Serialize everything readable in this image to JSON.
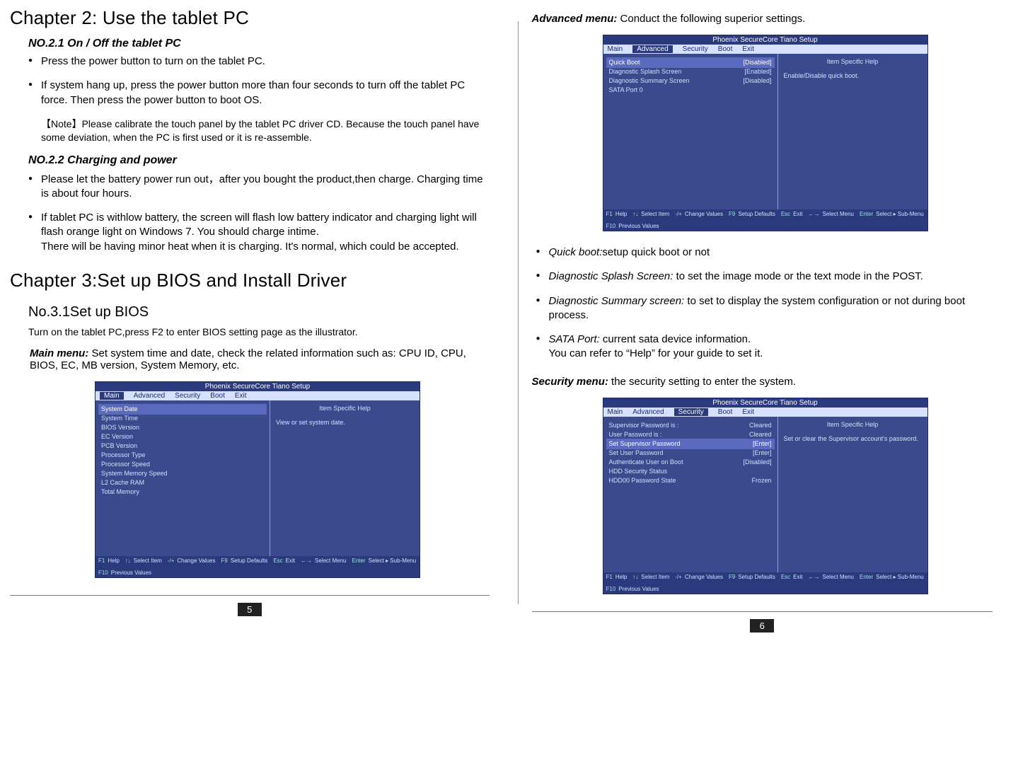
{
  "left": {
    "chapter2_title": "Chapter 2: Use the tablet PC",
    "sec21_title": "NO.2.1 On / Off the tablet PC",
    "sec21_items": [
      "Press the power button to turn on the tablet PC.",
      "If system hang up, press the power button more than four seconds to turn off  the tablet PC force. Then press the power button to boot OS."
    ],
    "note": "【Note】Please calibrate the touch panel by the tablet PC driver CD. Because the touch panel have some deviation, when the PC is first used or it is re-assemble.",
    "sec22_title": "NO.2.2 Charging and power",
    "sec22_items": [
      "Please let the battery power run out，after you bought the product,then charge. Charging time is about four hours.",
      "If tablet PC is withlow battery, the screen will flash low battery indicator and charging light will flash orange light on Windows 7. You should charge intime.\nThere will be having minor heat when it is charging. It's normal, which could be accepted."
    ],
    "chapter3_title": "Chapter 3:Set up  BIOS and Install Driver",
    "sec31_title": "No.3.1Set up  BIOS",
    "sec31_intro": "Turn on the tablet PC,press F2 to enter BIOS setting page as the illustrator.",
    "main_menu_lead": "Main menu:",
    "main_menu_desc": " Set system time and date, check the related information such as: CPU ID, CPU, BIOS, EC, MB version, System Memory, etc.",
    "page_num": "5"
  },
  "right": {
    "adv_lead": "Advanced menu:",
    "adv_desc": " Conduct the following superior settings.",
    "adv_items": [
      {
        "lead": "Quick boot:",
        "rest": "setup quick boot or not"
      },
      {
        "lead": "Diagnostic Splash Screen:",
        "rest": " to set the image mode or the text  mode in the POST."
      },
      {
        "lead": "Diagnostic Summary screen:",
        "rest": " to set to display the system configuration or not during boot process."
      },
      {
        "lead": "SATA Port:",
        "rest": " current sata device information.\nYou can refer to “Help” for your guide to set it."
      }
    ],
    "sec_lead": "Security menu:",
    "sec_desc": " the security setting to enter the system.",
    "page_num": "6"
  },
  "bios": {
    "title": "Phoenix SecureCore Tiano Setup",
    "tabs": [
      "Main",
      "Advanced",
      "Security",
      "Boot",
      "Exit"
    ],
    "help_hdr": "Item Specific Help",
    "footer": [
      {
        "k": "F1",
        "v": "Help"
      },
      {
        "k": "↑↓",
        "v": "Select Item"
      },
      {
        "k": "-/+",
        "v": "Change Values"
      },
      {
        "k": "F9",
        "v": "Setup Defaults"
      },
      {
        "k": "Esc",
        "v": "Exit"
      },
      {
        "k": "←→",
        "v": "Select Menu"
      },
      {
        "k": "Enter",
        "v": "Select ▸ Sub-Menu"
      },
      {
        "k": "F10",
        "v": "Previous Values"
      }
    ],
    "main": {
      "rows": [
        {
          "l": "System Date",
          "r": "",
          "hl": true
        },
        {
          "l": "System Time",
          "r": ""
        },
        {
          "l": "BIOS Version",
          "r": ""
        },
        {
          "l": "EC Version",
          "r": ""
        },
        {
          "l": "PCB Version",
          "r": ""
        },
        {
          "l": "Processor Type",
          "r": ""
        },
        {
          "l": "Processor Speed",
          "r": ""
        },
        {
          "l": "System Memory Speed",
          "r": ""
        },
        {
          "l": "L2 Cache RAM",
          "r": ""
        },
        {
          "l": "Total Memory",
          "r": ""
        }
      ],
      "help": "View or set system date."
    },
    "adv": {
      "rows": [
        {
          "l": "Quick Boot",
          "r": "[Disabled]",
          "hl": true
        },
        {
          "l": "Diagnostic Splash Screen",
          "r": "[Enabled]"
        },
        {
          "l": "Diagnostic Summary Screen",
          "r": "[Disabled]"
        },
        {
          "l": "SATA Port 0",
          "r": ""
        }
      ],
      "help": "Enable/Disable quick boot."
    },
    "sec": {
      "rows": [
        {
          "l": "Supervisor Password is :",
          "r": "Cleared"
        },
        {
          "l": "User Password is :",
          "r": "Cleared"
        },
        {
          "l": "",
          "r": ""
        },
        {
          "l": "Set Supervisor Password",
          "r": "[Enter]",
          "hl": true
        },
        {
          "l": "",
          "r": ""
        },
        {
          "l": "Set User Password",
          "r": "[Enter]"
        },
        {
          "l": "",
          "r": ""
        },
        {
          "l": "Authenticate User on Boot",
          "r": "[Disabled]"
        },
        {
          "l": "",
          "r": ""
        },
        {
          "l": "HDD Security Status",
          "r": ""
        },
        {
          "l": "HDD00 Password State",
          "r": "Frozen"
        }
      ],
      "help": "Set or clear the Supervisor account's password."
    }
  }
}
